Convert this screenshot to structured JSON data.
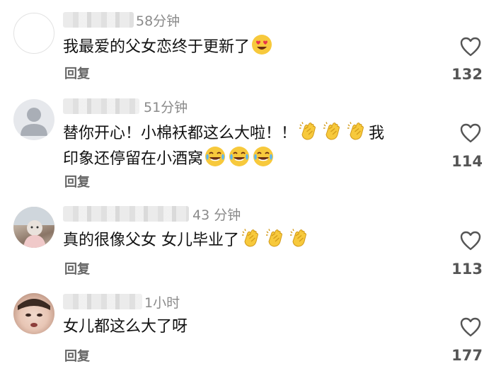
{
  "comments": [
    {
      "time": "58分钟",
      "text": "我最爱的父女恋终于更新了",
      "emojis": [
        "heart-eyes-emoji"
      ],
      "reply_label": "回复",
      "like_count": "132"
    },
    {
      "time": "51分钟",
      "text_line1": "替你开心！小棉袄都这么大啦！！",
      "text_line1_tail": "我",
      "text_line2": "印象还停留在小酒窝",
      "emojis_line1": [
        "clapping-hands-emoji",
        "clapping-hands-emoji",
        "clapping-hands-emoji"
      ],
      "emojis_line2": [
        "tears-of-joy-emoji",
        "tears-of-joy-emoji",
        "tears-of-joy-emoji"
      ],
      "reply_label": "回复",
      "like_count": "114"
    },
    {
      "time": "43 分钟",
      "text": "真的很像父女 女儿毕业了",
      "emojis": [
        "clapping-hands-emoji",
        "clapping-hands-emoji",
        "clapping-hands-emoji"
      ],
      "reply_label": "回复",
      "like_count": "113"
    },
    {
      "time": "1小时",
      "text": "女儿都这么大了呀",
      "reply_label": "回复",
      "like_count": "177"
    }
  ],
  "colors": {
    "text": "#111111",
    "muted": "#8a8a8a",
    "reply": "#666666",
    "emoji_yellow": "#f7c93c"
  },
  "icons": {
    "like": "heart-outline-icon"
  }
}
